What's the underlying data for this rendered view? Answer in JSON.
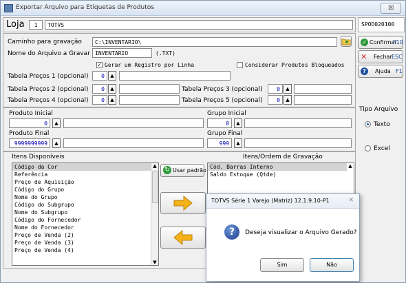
{
  "window": {
    "title": "Exportar Arquivo para Etiquetas de Produtos",
    "close_label": "☒"
  },
  "header": {
    "loja_label": "Loja",
    "loja_num": "1",
    "loja_name": "TOTVS",
    "code": "SPOD020100"
  },
  "form": {
    "caminho_label": "Caminho para gravação",
    "caminho_value": "C:\\INVENTARIO\\",
    "nome_label": "Nome do Arquivo a Gravar",
    "nome_value": "INVENTARIO",
    "ext_label": "(.TXT)",
    "gerar_label": "Gerar um Registro por Linha",
    "considerar_label": "Considerar Produtos Bloqueados",
    "tp1_label": "Tabela Preços 1 (opcional)",
    "tp2_label": "Tabela Preços 2 (opcional)",
    "tp3_label": "Tabela Preços 3 (opcional)",
    "tp4_label": "Tabela Preços 4 (opcional)",
    "tp5_label": "Tabela Preços 5 (opcional)",
    "tp1_value": "0",
    "tp2_value": "0",
    "tp3_value": "0",
    "tp4_value": "0",
    "tp5_value": "0"
  },
  "range": {
    "prod_ini_label": "Produto Inicial",
    "prod_ini_value": "0",
    "prod_fin_label": "Produto Final",
    "prod_fin_value": "9999999999",
    "grupo_ini_label": "Grupo Inicial",
    "grupo_ini_value": "0",
    "grupo_fin_label": "Grupo Final",
    "grupo_fin_value": "999"
  },
  "lists": {
    "disponiveis_label": "Itens Disponíveis",
    "disponiveis": [
      "Código da Cor",
      "Referência",
      "Preço de Aquisição",
      "Código do Grupo",
      "Nome do Grupo",
      "Código do Subgrupo",
      "Nome do Subgrupo",
      "Código do Fornecedor",
      "Nome do Fornecedor",
      "Preço de Venda (2)",
      "Preço de Venda (3)",
      "Preço de Venda (4)"
    ],
    "ordem_label": "Itens/Ordem de Gravação",
    "ordem": [
      "Cód. Barras Interno",
      "Saldo Estoque (Qtde)"
    ],
    "usar_padrao": "Usar padrão"
  },
  "side": {
    "confirmar": "Confirmar",
    "confirmar_key": "F10",
    "fechar": "Fechar",
    "fechar_key": "ESC",
    "ajuda": "Ajuda",
    "ajuda_key": "F1",
    "tipo_label": "Tipo Arquivo",
    "texto": "Texto",
    "excel": "Excel"
  },
  "dialog": {
    "title": "TOTVS Série 1 Varejo (Matriz) 12.1.9.10-P1",
    "message": "Deseja visualizar o Arquivo Gerado?",
    "yes": "Sim",
    "no": "Não"
  },
  "colors": {
    "accent": "#1c4e9c",
    "confirm": "#2e9a3a",
    "close": "#d22c2c",
    "arrow": "#f5b21a"
  }
}
